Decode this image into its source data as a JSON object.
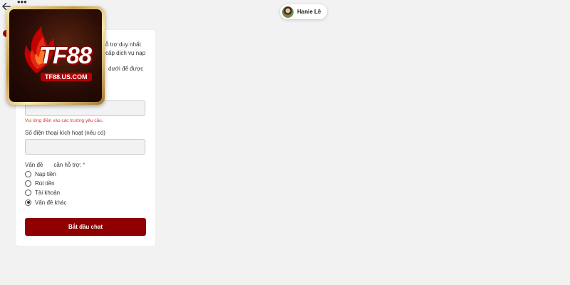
{
  "header": {
    "agent_name": "Hanie Lê"
  },
  "logo": {
    "brand": "TF88",
    "domain": "TF88.US.COM"
  },
  "intro": {
    "lines": [
      "ỗ trợ duy nhất",
      "cấp dịch vụ nạp",
      "dưới để được"
    ]
  },
  "form": {
    "error_text": "Vui lòng điền vào các trường yêu cầu.",
    "phone_label": "Số điện thoại kích hoạt (nếu có)",
    "topic_label_part1": "Vấn đề",
    "topic_label_part2": "cần hỗ trợ:",
    "required_mark": "*",
    "options": [
      "Nạp tiền",
      "Rút tiền",
      "Tài khoản",
      "Vấn đề khác"
    ],
    "selected_option": "Vấn đề khác",
    "submit_label": "Bắt đầu chat"
  },
  "colors": {
    "brand_red": "#8f0000",
    "error_red": "#d9362b",
    "background": "#f2f2f3"
  },
  "icons": [
    "back-arrow-icon",
    "more-options-icon",
    "agent-avatar",
    "flame-icon"
  ]
}
